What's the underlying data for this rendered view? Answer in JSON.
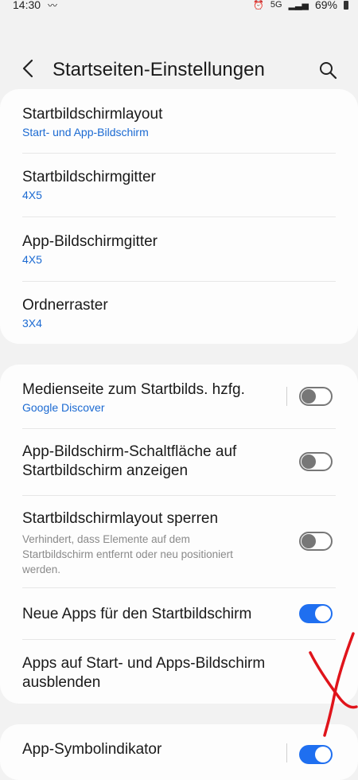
{
  "status": {
    "time": "14:30",
    "battery": "69%",
    "network": "5G"
  },
  "header": {
    "title": "Startseiten-Einstellungen"
  },
  "card1": {
    "items": [
      {
        "title": "Startbildschirmlayout",
        "value": "Start- und App-Bildschirm"
      },
      {
        "title": "Startbildschirmgitter",
        "value": "4X5"
      },
      {
        "title": "App-Bildschirmgitter",
        "value": "4X5"
      },
      {
        "title": "Ordnerraster",
        "value": "3X4"
      }
    ]
  },
  "card2": {
    "media": {
      "title": "Medienseite zum Startbilds. hzfg.",
      "value": "Google Discover",
      "enabled": false
    },
    "appsbutton": {
      "title_line1": "App-Bildschirm-Schaltfläche auf",
      "title_line2": "Startbildschirm anzeigen",
      "enabled": false
    },
    "lock": {
      "title": "Startbildschirmlayout sperren",
      "desc_line1": "Verhindert, dass Elemente auf dem",
      "desc_line2": "Startbildschirm entfernt oder neu positioniert",
      "desc_line3": "werden.",
      "enabled": false
    },
    "newapps": {
      "title": "Neue Apps für den Startbildschirm",
      "enabled": true
    },
    "hide": {
      "title_line1": "Apps auf Start- und Apps-Bildschirm",
      "title_line2": "ausblenden"
    }
  },
  "card3": {
    "badge": {
      "title": "App-Symbolindikator",
      "enabled": true
    }
  },
  "colors": {
    "accent": "#1f6ff0",
    "link": "#1b6ad2",
    "annotation": "#e0141b"
  }
}
